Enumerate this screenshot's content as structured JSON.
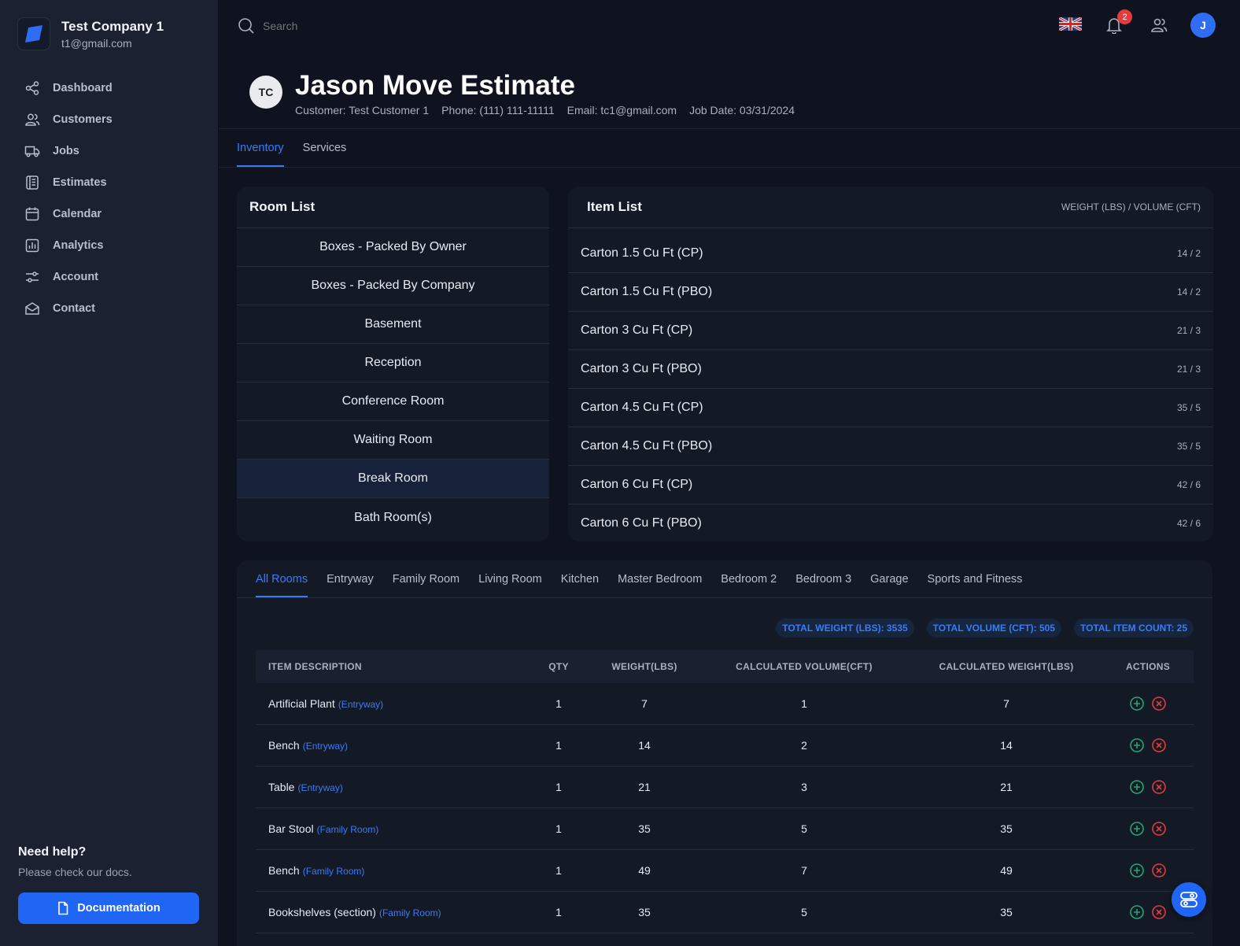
{
  "company": {
    "name": "Test Company 1",
    "email": "t1@gmail.com"
  },
  "nav": [
    {
      "label": "Dashboard",
      "icon": "share-icon"
    },
    {
      "label": "Customers",
      "icon": "users-icon"
    },
    {
      "label": "Jobs",
      "icon": "truck-icon"
    },
    {
      "label": "Estimates",
      "icon": "document-icon"
    },
    {
      "label": "Calendar",
      "icon": "calendar-icon"
    },
    {
      "label": "Analytics",
      "icon": "chart-icon"
    },
    {
      "label": "Account",
      "icon": "sliders-icon"
    },
    {
      "label": "Contact",
      "icon": "mail-icon"
    }
  ],
  "help": {
    "title": "Need help?",
    "subtitle": "Please check our docs.",
    "button": "Documentation"
  },
  "topbar": {
    "search_placeholder": "Search",
    "notification_count": "2",
    "avatar_initial": "J"
  },
  "estimate": {
    "initials": "TC",
    "title": "Jason Move Estimate",
    "customer": "Customer: Test Customer 1",
    "phone": "Phone: (111) 111-11111",
    "email": "Email: tc1@gmail.com",
    "job_date": "Job Date: 03/31/2024"
  },
  "tabs": {
    "inventory": "Inventory",
    "services": "Services"
  },
  "room_list": {
    "title": "Room List",
    "rooms": [
      "Boxes - Packed By Owner",
      "Boxes - Packed By Company",
      "Basement",
      "Reception",
      "Conference Room",
      "Waiting Room",
      "Break Room",
      "Bath Room(s)"
    ]
  },
  "item_list": {
    "title": "Item List",
    "note": "WEIGHT (LBS) / VOLUME (CFT)",
    "items": [
      {
        "name": "Carton 1.5 Cu Ft (CP)",
        "wv": "14 / 2"
      },
      {
        "name": "Carton 1.5 Cu Ft (PBO)",
        "wv": "14 / 2"
      },
      {
        "name": "Carton 3 Cu Ft (CP)",
        "wv": "21 / 3"
      },
      {
        "name": "Carton 3 Cu Ft (PBO)",
        "wv": "21 / 3"
      },
      {
        "name": "Carton 4.5 Cu Ft (CP)",
        "wv": "35 / 5"
      },
      {
        "name": "Carton 4.5 Cu Ft (PBO)",
        "wv": "35 / 5"
      },
      {
        "name": "Carton 6 Cu Ft (CP)",
        "wv": "42 / 6"
      },
      {
        "name": "Carton 6 Cu Ft (PBO)",
        "wv": "42 / 6"
      }
    ]
  },
  "room_tabs": [
    "All Rooms",
    "Entryway",
    "Family Room",
    "Living Room",
    "Kitchen",
    "Master Bedroom",
    "Bedroom 2",
    "Bedroom 3",
    "Garage",
    "Sports and Fitness"
  ],
  "totals": {
    "weight": "TOTAL WEIGHT (LBS): 3535",
    "volume": "TOTAL VOLUME (CFT): 505",
    "count": "TOTAL ITEM COUNT: 25"
  },
  "table": {
    "headers": {
      "desc": "ITEM DESCRIPTION",
      "qty": "QTY",
      "weight": "WEIGHT(LBS)",
      "cvol": "CALCULATED VOLUME(CFT)",
      "cweight": "CALCULATED WEIGHT(LBS)",
      "actions": "ACTIONS"
    },
    "rows": [
      {
        "desc": "Artificial Plant",
        "room": "(Entryway)",
        "qty": "1",
        "weight": "7",
        "cvol": "1",
        "cweight": "7"
      },
      {
        "desc": "Bench",
        "room": "(Entryway)",
        "qty": "1",
        "weight": "14",
        "cvol": "2",
        "cweight": "14"
      },
      {
        "desc": "Table",
        "room": "(Entryway)",
        "qty": "1",
        "weight": "21",
        "cvol": "3",
        "cweight": "21"
      },
      {
        "desc": "Bar Stool",
        "room": "(Family Room)",
        "qty": "1",
        "weight": "35",
        "cvol": "5",
        "cweight": "35"
      },
      {
        "desc": "Bench",
        "room": "(Family Room)",
        "qty": "1",
        "weight": "49",
        "cvol": "7",
        "cweight": "49"
      },
      {
        "desc": "Bookshelves (section)",
        "room": "(Family Room)",
        "qty": "1",
        "weight": "35",
        "cvol": "5",
        "cweight": "35"
      }
    ]
  },
  "colors": {
    "accent": "#3b7bf5",
    "add": "#1fa971",
    "remove": "#e33c3c"
  }
}
